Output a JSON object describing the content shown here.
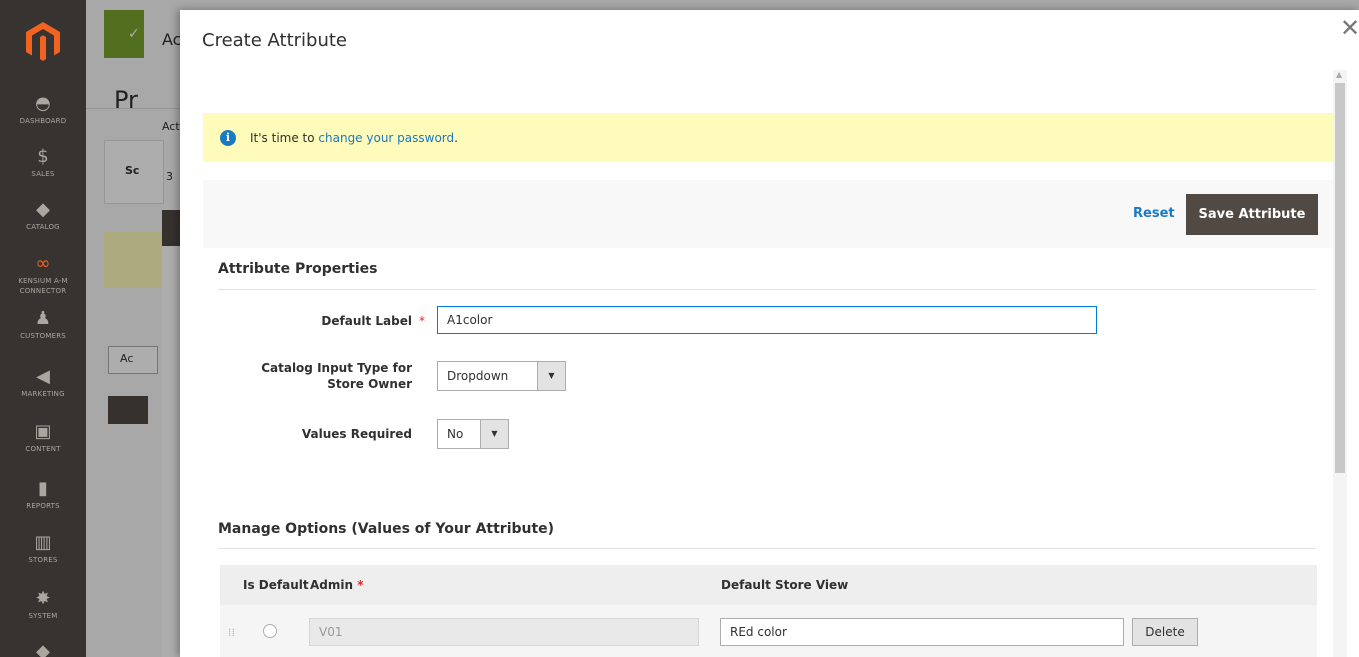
{
  "sidebar": {
    "items": [
      {
        "label": "DASHBOARD",
        "icon": "dashboard-icon",
        "glyph": "◓"
      },
      {
        "label": "SALES",
        "icon": "dollar-icon",
        "glyph": "$"
      },
      {
        "label": "CATALOG",
        "icon": "box-icon",
        "glyph": "◆"
      },
      {
        "label": "KENSIUM A-M",
        "label2": "CONNECTOR",
        "icon": "connector-icon",
        "glyph": "∞"
      },
      {
        "label": "CUSTOMERS",
        "icon": "person-icon",
        "glyph": "♟"
      },
      {
        "label": "MARKETING",
        "icon": "megaphone-icon",
        "glyph": "◀"
      },
      {
        "label": "CONTENT",
        "icon": "layout-icon",
        "glyph": "▣"
      },
      {
        "label": "REPORTS",
        "icon": "bar-chart-icon",
        "glyph": "▮"
      },
      {
        "label": "STORES",
        "icon": "store-icon",
        "glyph": "▥"
      },
      {
        "label": "SYSTEM",
        "icon": "gear-icon",
        "glyph": "✸"
      },
      {
        "label": "",
        "icon": "box-icon",
        "glyph": "◆"
      }
    ]
  },
  "background": {
    "check_label": "✓",
    "ac_label": "Ac",
    "pr_label": "Pr",
    "act_label": "Act",
    "sc_label": "Sc",
    "three_label": "3",
    "ac2_label": "Ac"
  },
  "modal": {
    "title": "Create Attribute",
    "close_glyph": "✕",
    "notice": {
      "prefix": "It's time to ",
      "link": "change your password",
      "suffix": "."
    },
    "actions": {
      "reset_label": "Reset",
      "save_label": "Save Attribute"
    },
    "properties": {
      "section_title": "Attribute Properties",
      "default_label_label": "Default Label",
      "default_label_value": "A1color",
      "input_type_label_line1": "Catalog Input Type for",
      "input_type_label_line2": "Store Owner",
      "input_type_value": "Dropdown",
      "values_required_label": "Values Required",
      "values_required_value": "No"
    },
    "options": {
      "section_title": "Manage Options (Values of Your Attribute)",
      "columns": [
        "Is Default",
        "Admin",
        "Default Store View"
      ],
      "rows": [
        {
          "admin": "V01",
          "store_view": "REd color",
          "delete_label": "Delete"
        }
      ]
    }
  }
}
